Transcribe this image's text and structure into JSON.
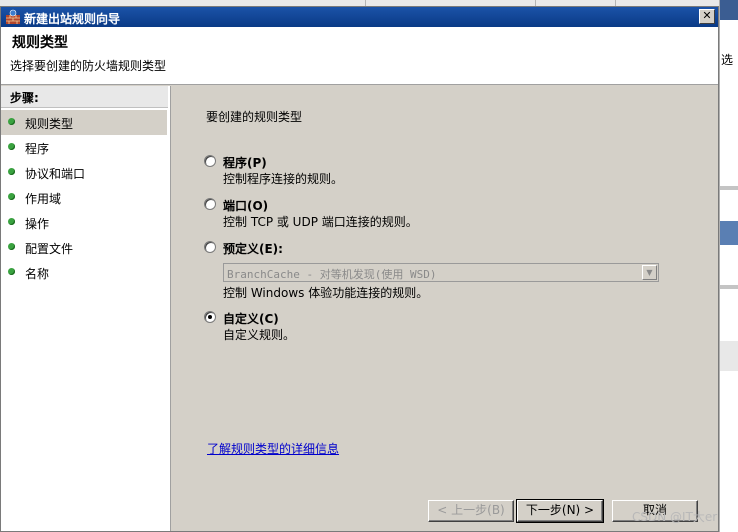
{
  "background": {
    "right_text": "选"
  },
  "dialog": {
    "title": "新建出站规则向导",
    "close_glyph": "✕",
    "header_title": "规则类型",
    "header_subtitle": "选择要创建的防火墙规则类型"
  },
  "steps": {
    "heading": "步骤:",
    "items": [
      {
        "label": "规则类型",
        "active": true
      },
      {
        "label": "程序"
      },
      {
        "label": "协议和端口"
      },
      {
        "label": "作用域"
      },
      {
        "label": "操作"
      },
      {
        "label": "配置文件"
      },
      {
        "label": "名称"
      }
    ]
  },
  "content": {
    "prompt": "要创建的规则类型",
    "options": [
      {
        "label": "程序(P)",
        "desc": "控制程序连接的规则。",
        "checked": false
      },
      {
        "label": "端口(O)",
        "desc": "控制 TCP 或 UDP 端口连接的规则。",
        "checked": false
      },
      {
        "label": "预定义(E):",
        "desc": "控制 Windows 体验功能连接的规则。",
        "checked": false
      },
      {
        "label": "自定义(C)",
        "desc": "自定义规则。",
        "checked": true
      }
    ],
    "predefined_select": "BranchCache - 对等机发现(使用 WSD)",
    "help_link": "了解规则类型的详细信息"
  },
  "buttons": {
    "back": "< 上一步(B)",
    "next": "下一步(N) >",
    "cancel": "取消"
  },
  "watermark": "CSDN @IT大er"
}
